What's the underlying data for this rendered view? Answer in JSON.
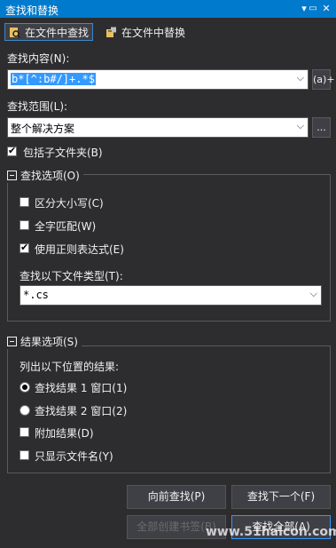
{
  "window": {
    "title": "查找和替换"
  },
  "tabs": [
    {
      "label": "在文件中查找",
      "active": true
    },
    {
      "label": "在文件中替换",
      "active": false
    }
  ],
  "find_what": {
    "label": "查找内容(N):",
    "value": "b*[^:b#/]+.*$",
    "regex_button": "(a)+"
  },
  "look_in": {
    "label": "查找范围(L):",
    "value": "整个解决方案",
    "browse_button": "..."
  },
  "include_subfolders": {
    "label": "包括子文件夹(B)",
    "checked": true
  },
  "find_options": {
    "title": "查找选项(O)",
    "match_case": {
      "label": "区分大小写(C)",
      "checked": false
    },
    "whole_word": {
      "label": "全字匹配(W)",
      "checked": false
    },
    "use_regex": {
      "label": "使用正则表达式(E)",
      "checked": true
    },
    "file_types_label": "查找以下文件类型(T):",
    "file_types_value": "*.cs"
  },
  "result_options": {
    "title": "结果选项(S)",
    "list_label": "列出以下位置的结果:",
    "window1": {
      "label": "查找结果 1 窗口(1)",
      "selected": true
    },
    "window2": {
      "label": "查找结果 2 窗口(2)",
      "selected": false
    },
    "append": {
      "label": "附加结果(D)",
      "checked": false
    },
    "files_only": {
      "label": "只显示文件名(Y)",
      "checked": false
    }
  },
  "buttons": {
    "find_previous": "向前查找(P)",
    "find_next": "查找下一个(F)",
    "bookmark_all": "全部创建书签(B)",
    "find_all": "查找全部(A)"
  },
  "watermark": "www.51halcon.com",
  "colors": {
    "accent": "#007acc",
    "background": "#2d2d30",
    "selection": "#3399ff"
  }
}
